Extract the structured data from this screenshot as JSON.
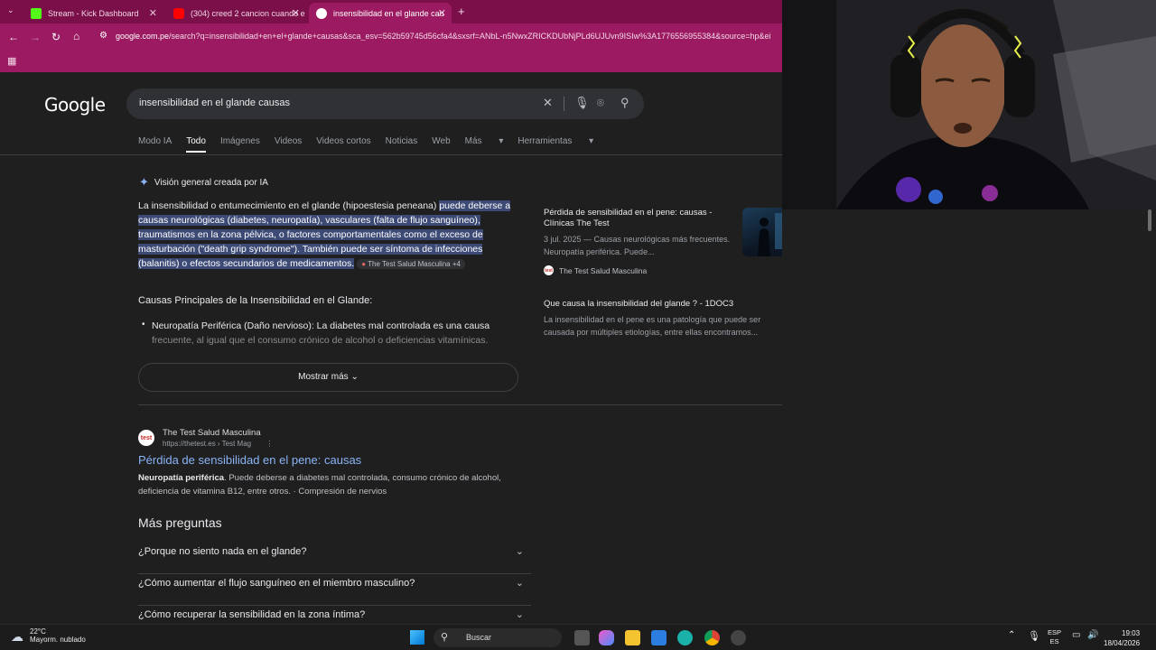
{
  "browser": {
    "tabs": [
      {
        "title": "Stream - Kick Dashboard",
        "favicon": "kick-icon",
        "color": "#53fc18"
      },
      {
        "title": "(304) creed 2 cancion cuando e",
        "favicon": "youtube-icon",
        "color": "#ff0000"
      },
      {
        "title": "insensibilidad en el glande cau",
        "favicon": "google-icon",
        "color": "#ffffff"
      }
    ],
    "new_tab": "+",
    "url_domain": "google.com.pe",
    "url_rest": "/search?q=insensibilidad+en+el+glande+causas&sca_esv=562b59745d56cfa4&sxsrf=ANbL-n5NwxZRICKDUbNjPLd6UJUvn9ISIw%3A1776556955384&source=hp&ei"
  },
  "google": {
    "logo": "Google",
    "query": "insensibilidad en el glande causas",
    "filters": [
      "Modo IA",
      "Todo",
      "Imágenes",
      "Videos",
      "Videos cortos",
      "Noticias",
      "Web",
      "Más",
      "Herramientas"
    ],
    "active_filter": "Todo"
  },
  "ai_overview": {
    "header": "Visión general creada por IA",
    "text_plain": "La insensibilidad o entumecimiento en el glande (hipoestesia peneana) ",
    "text_highlight": "puede deberse a causas neurológicas (diabetes, neuropatía), vasculares (falta de flujo sanguíneo), traumatismos en la zona pélvica, o factores comportamentales como el exceso de masturbación (\"death grip syndrome\"). También puede ser síntoma de infecciones (balanitis) o efectos secundarios de medicamentos",
    "source_chip": "The Test Salud Masculina +4",
    "causes_title": "Causas Principales de la Insensibilidad en el Glande:",
    "bullet_bold": "Neuropatía Periférica (Daño nervioso):",
    "bullet_text": " La diabetes mal controlada es una causa",
    "bullet_fade": "frecuente, al igual que el consumo crónico de alcohol o deficiencias vitamínicas.",
    "show_more": "Mostrar más",
    "cards": [
      {
        "title": "Pérdida de sensibilidad en el pene: causas - Clínicas The Test",
        "desc": "3 jul. 2025 — Causas neurológicas más frecuentes. Neuropatía periférica. Puede...",
        "source": "The Test Salud Masculina"
      },
      {
        "title": "Que causa la insensibilidad del glande ? - 1DOC3",
        "desc": "La insensibilidad en el pene es una patología que puede ser causada por múltiples etiologías, entre ellas encontramos..."
      }
    ]
  },
  "result1": {
    "favicon": "test",
    "site": "The Test Salud Masculina",
    "url": "https://thetest.es › Test Mag",
    "title": "Pérdida de sensibilidad en el pene: causas",
    "snippet_bold": "Neuropatía periférica",
    "snippet": ". Puede deberse a diabetes mal controlada, consumo crónico de alcohol, deficiencia de vitamina B12, entre otros. · Compresión de nervios"
  },
  "ppa": {
    "title": "Más preguntas",
    "questions": [
      "¿Porque no siento nada en el glande?",
      "¿Cómo aumentar el flujo sanguíneo en el miembro masculino?",
      "¿Cómo recuperar la sensibilidad en la zona íntima?"
    ]
  },
  "taskbar": {
    "temp": "22°C",
    "weather": "Mayorm. nublado",
    "search": "Buscar",
    "lang1": "ESP",
    "lang2": "ES",
    "time": "19:03",
    "date": "18/04/2026"
  }
}
